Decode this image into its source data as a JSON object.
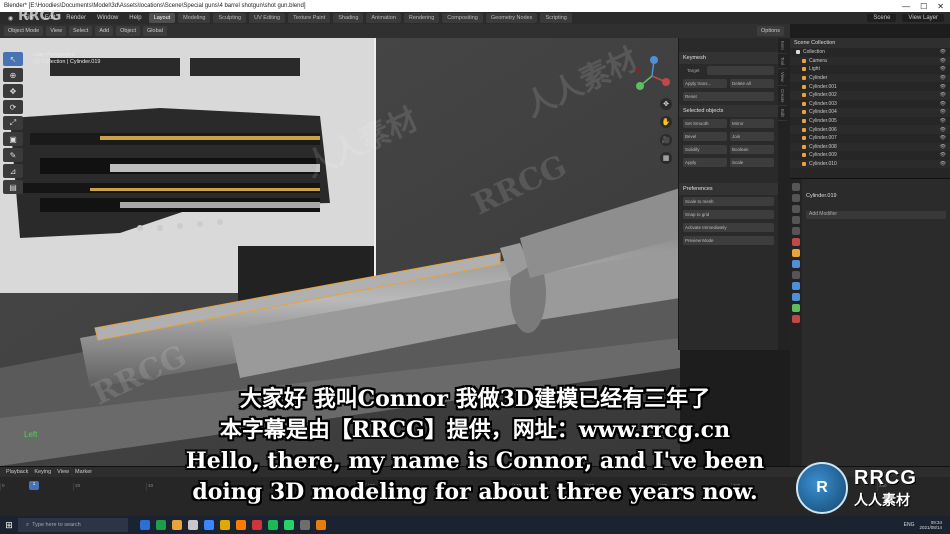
{
  "window": {
    "title": "Blender* [E:\\Hoodies\\Documents\\Model\\3d\\Assets\\locations\\Scene\\Special guns\\4 barrel shotgun\\shot gun.blend]",
    "controls": [
      "—",
      "☐",
      "✕"
    ]
  },
  "watermark": {
    "top_text": "RRCG",
    "faint": [
      "人人素材",
      "RRCG",
      "人人素材",
      "RRCG"
    ],
    "logo_text": "RRCG",
    "logo_sub": "人人素材"
  },
  "menubar": {
    "menus": [
      "File",
      "Edit",
      "Render",
      "Window",
      "Help"
    ],
    "workspaces": [
      "Layout",
      "Modeling",
      "Sculpting",
      "UV Editing",
      "Texture Paint",
      "Shading",
      "Animation",
      "Rendering",
      "Compositing",
      "Geometry Nodes",
      "Scripting"
    ],
    "active_workspace": "Layout",
    "scene": "Scene",
    "view_layer": "View Layer"
  },
  "header": {
    "items": [
      "Object Mode",
      "View",
      "Select",
      "Add",
      "Object",
      "Global",
      "Options"
    ]
  },
  "viewport": {
    "info_line1": "User Perspective",
    "info_line2": "(1) Collection | Cylinder.019",
    "left_label": "Left"
  },
  "tools": [
    "↖",
    "⊕",
    "✥",
    "⟳",
    "⤢",
    "▣",
    "✎",
    "⊿",
    "▤"
  ],
  "nav_icons": [
    "✥",
    "✋",
    "🎥",
    "▦"
  ],
  "npanel": {
    "sections": [
      "Keymesh",
      "Selected objects",
      "Preferences"
    ],
    "target_label": "Target",
    "buttons": [
      "Apply trans...",
      "Delete all",
      "Reset",
      "Set Smooth",
      "Mirror",
      "Bevel",
      "Join",
      "Solidify",
      "Boolean",
      "Apply",
      "Scale",
      "Scale to mesh",
      "Snap to grid",
      "Activate Immediately",
      "Preview Mode"
    ]
  },
  "side_tabs": [
    "Item",
    "Tool",
    "View",
    "Create",
    "Edit"
  ],
  "outliner": {
    "title": "Scene Collection",
    "collection": "Collection",
    "rows": [
      "Camera",
      "Light",
      "Cylinder",
      "Cylinder.001",
      "Cylinder.002",
      "Cylinder.003",
      "Cylinder.004",
      "Cylinder.005",
      "Cylinder.006",
      "Cylinder.007",
      "Cylinder.008",
      "Cylinder.009",
      "Cylinder.010"
    ]
  },
  "properties": {
    "object_name": "Cylinder.019",
    "modifier_label": "Add Modifier"
  },
  "timeline": {
    "menus": [
      "Playback",
      "Keying",
      "View",
      "Marker"
    ],
    "current_frame": "1",
    "ruler": [
      "0",
      "20",
      "40",
      "60",
      "80",
      "100",
      "120",
      "140",
      "160",
      "180",
      "200",
      "220",
      "240"
    ]
  },
  "subtitles": {
    "line1": "大家好 我叫Connor 我做3D建模已经有三年了",
    "line2": "本字幕是由【RRCG】提供，网址：www.rrcg.cn",
    "line3": "Hello, there, my name is Connor, and I've been",
    "line4": "doing 3D modeling for about three years now."
  },
  "taskbar": {
    "search_placeholder": "Type here to search",
    "tray_lang": "ENG",
    "clock_time": "09:34",
    "clock_date": "2021/08/14",
    "app_colors": [
      "#2b6fd6",
      "#1e9e4a",
      "#e8a33b",
      "#c8c8c8",
      "#3a86ff",
      "#e0a800",
      "#ff7b00",
      "#d13438",
      "#1db954",
      "#25d366",
      "#6e6e6e",
      "#e87d0d"
    ]
  }
}
